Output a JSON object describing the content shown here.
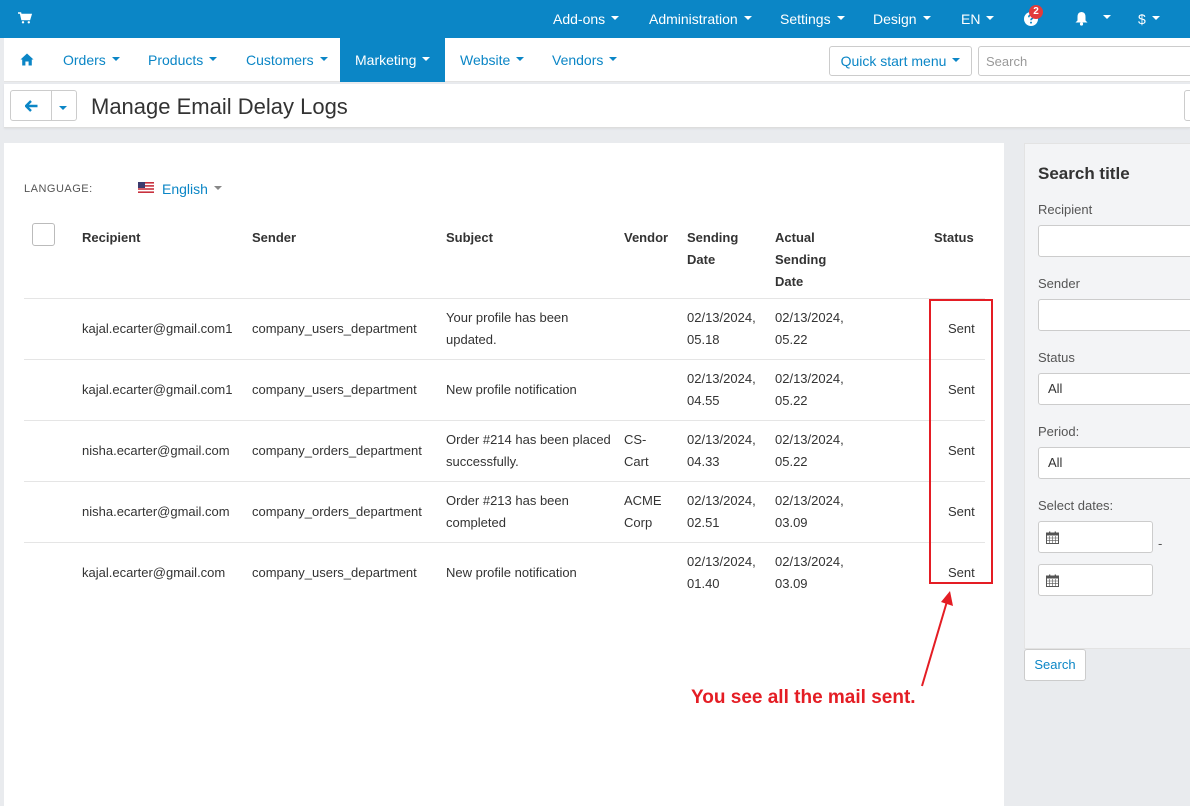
{
  "topbar": {
    "menus": [
      {
        "label": "Add-ons"
      },
      {
        "label": "Administration"
      },
      {
        "label": "Settings"
      },
      {
        "label": "Design"
      },
      {
        "label": "EN"
      },
      {
        "label": "$"
      }
    ],
    "notification_count": "2",
    "accent_color": "#0b86c6"
  },
  "nav": {
    "items": [
      {
        "label": "Orders"
      },
      {
        "label": "Products"
      },
      {
        "label": "Customers"
      },
      {
        "label": "Marketing"
      },
      {
        "label": "Website"
      },
      {
        "label": "Vendors"
      }
    ],
    "active": "Marketing",
    "quick_start": "Quick start menu",
    "search_placeholder": "Search"
  },
  "page": {
    "title": "Manage Email Delay Logs"
  },
  "language": {
    "label": "LANGUAGE:",
    "value": "English"
  },
  "table": {
    "headers": {
      "recipient": "Recipient",
      "sender": "Sender",
      "subject": "Subject",
      "vendor": "Vendor",
      "sending_date": "Sending Date",
      "actual_sending_date": "Actual Sending Date",
      "status": "Status"
    },
    "rows": [
      {
        "recipient": "kajal.ecarter@gmail.com1",
        "sender": "company_users_department",
        "subject": "Your profile has been updated.",
        "vendor": "",
        "sending_date": "02/13/2024, 05.18",
        "actual_sending_date": "02/13/2024, 05.22",
        "status": "Sent"
      },
      {
        "recipient": "kajal.ecarter@gmail.com1",
        "sender": "company_users_department",
        "subject": "New profile notification",
        "vendor": "",
        "sending_date": "02/13/2024, 04.55",
        "actual_sending_date": "02/13/2024, 05.22",
        "status": "Sent"
      },
      {
        "recipient": "nisha.ecarter@gmail.com",
        "sender": "company_orders_department",
        "subject": "Order #214 has been placed successfully.",
        "vendor": "CS-Cart",
        "sending_date": "02/13/2024, 04.33",
        "actual_sending_date": "02/13/2024, 05.22",
        "status": "Sent"
      },
      {
        "recipient": "nisha.ecarter@gmail.com",
        "sender": "company_orders_department",
        "subject": "Order #213 has been completed",
        "vendor": "ACME Corp",
        "sending_date": "02/13/2024, 02.51",
        "actual_sending_date": "02/13/2024, 03.09",
        "status": "Sent"
      },
      {
        "recipient": "kajal.ecarter@gmail.com",
        "sender": "company_users_department",
        "subject": "New profile notification",
        "vendor": "",
        "sending_date": "02/13/2024, 01.40",
        "actual_sending_date": "02/13/2024, 03.09",
        "status": "Sent"
      }
    ]
  },
  "annotation": {
    "text": "You see all the mail sent.",
    "color": "#e41d24"
  },
  "sidebar": {
    "title": "Search title",
    "recipient_label": "Recipient",
    "recipient_value": "",
    "sender_label": "Sender",
    "sender_value": "",
    "status_label": "Status",
    "status_value": "All",
    "period_label": "Period:",
    "period_value": "All",
    "dates_label": "Select dates:",
    "dates_separator": "-",
    "search_button": "Search"
  }
}
